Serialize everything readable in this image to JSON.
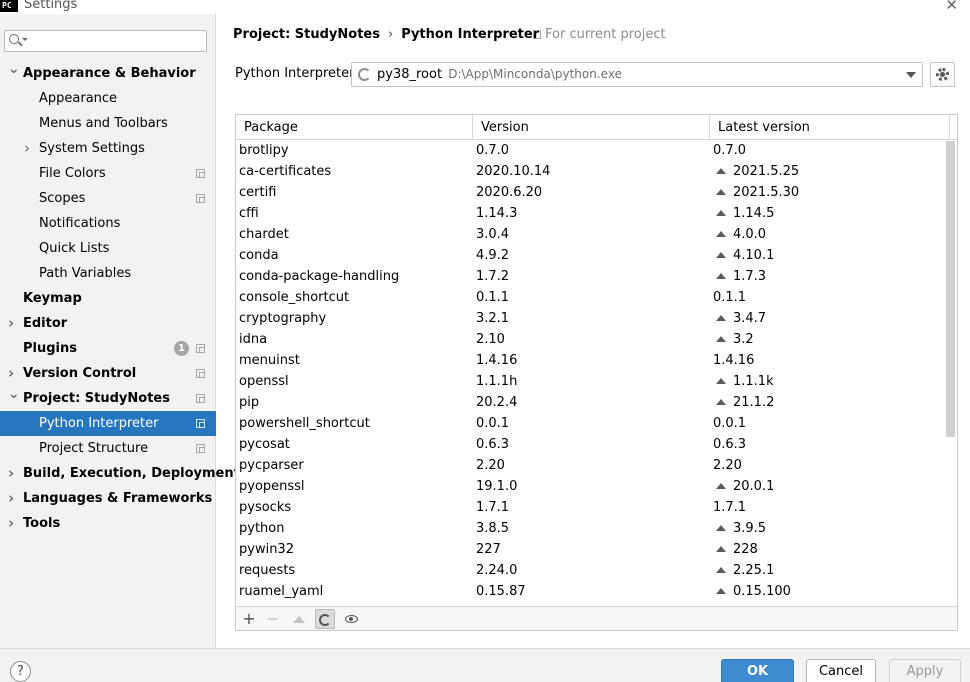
{
  "window": {
    "title": "Settings",
    "app_icon_text": "PC"
  },
  "search": {
    "placeholder": ""
  },
  "sidebar": {
    "items": [
      {
        "label": "Appearance & Behavior",
        "bold": true,
        "arrow": "down"
      },
      {
        "label": "Appearance",
        "child": true
      },
      {
        "label": "Menus and Toolbars",
        "child": true
      },
      {
        "label": "System Settings",
        "child": true,
        "arrow": "right"
      },
      {
        "label": "File Colors",
        "child": true,
        "copy": true
      },
      {
        "label": "Scopes",
        "child": true,
        "copy": true
      },
      {
        "label": "Notifications",
        "child": true
      },
      {
        "label": "Quick Lists",
        "child": true
      },
      {
        "label": "Path Variables",
        "child": true
      },
      {
        "label": "Keymap",
        "bold": true
      },
      {
        "label": "Editor",
        "bold": true,
        "arrow": "right"
      },
      {
        "label": "Plugins",
        "bold": true,
        "badge": "1",
        "copy": true
      },
      {
        "label": "Version Control",
        "bold": true,
        "arrow": "right",
        "copy": true
      },
      {
        "label": "Project: StudyNotes",
        "bold": true,
        "arrow": "down",
        "copy": true
      },
      {
        "label": "Python Interpreter",
        "child": true,
        "copy": true,
        "selected": true
      },
      {
        "label": "Project Structure",
        "child": true,
        "copy": true
      },
      {
        "label": "Build, Execution, Deployment",
        "bold": true,
        "arrow": "right"
      },
      {
        "label": "Languages & Frameworks",
        "bold": true,
        "arrow": "right"
      },
      {
        "label": "Tools",
        "bold": true,
        "arrow": "right"
      }
    ]
  },
  "breadcrumb": {
    "project": "Project: StudyNotes",
    "separator": "›",
    "page": "Python Interpreter"
  },
  "scope_note": "For current project",
  "interpreter": {
    "label": "Python Interpreter:",
    "name": "py38_root",
    "path": "D:\\App\\Minconda\\python.exe"
  },
  "table": {
    "columns": [
      "Package",
      "Version",
      "Latest version"
    ],
    "rows": [
      {
        "package": "brotlipy",
        "version": "0.7.0",
        "latest": "0.7.0",
        "upgrade": false
      },
      {
        "package": "ca-certificates",
        "version": "2020.10.14",
        "latest": "2021.5.25",
        "upgrade": true
      },
      {
        "package": "certifi",
        "version": "2020.6.20",
        "latest": "2021.5.30",
        "upgrade": true
      },
      {
        "package": "cffi",
        "version": "1.14.3",
        "latest": "1.14.5",
        "upgrade": true
      },
      {
        "package": "chardet",
        "version": "3.0.4",
        "latest": "4.0.0",
        "upgrade": true
      },
      {
        "package": "conda",
        "version": "4.9.2",
        "latest": "4.10.1",
        "upgrade": true
      },
      {
        "package": "conda-package-handling",
        "version": "1.7.2",
        "latest": "1.7.3",
        "upgrade": true
      },
      {
        "package": "console_shortcut",
        "version": "0.1.1",
        "latest": "0.1.1",
        "upgrade": false
      },
      {
        "package": "cryptography",
        "version": "3.2.1",
        "latest": "3.4.7",
        "upgrade": true
      },
      {
        "package": "idna",
        "version": "2.10",
        "latest": "3.2",
        "upgrade": true
      },
      {
        "package": "menuinst",
        "version": "1.4.16",
        "latest": "1.4.16",
        "upgrade": false
      },
      {
        "package": "openssl",
        "version": "1.1.1h",
        "latest": "1.1.1k",
        "upgrade": true
      },
      {
        "package": "pip",
        "version": "20.2.4",
        "latest": "21.1.2",
        "upgrade": true
      },
      {
        "package": "powershell_shortcut",
        "version": "0.0.1",
        "latest": "0.0.1",
        "upgrade": false
      },
      {
        "package": "pycosat",
        "version": "0.6.3",
        "latest": "0.6.3",
        "upgrade": false
      },
      {
        "package": "pycparser",
        "version": "2.20",
        "latest": "2.20",
        "upgrade": false
      },
      {
        "package": "pyopenssl",
        "version": "19.1.0",
        "latest": "20.0.1",
        "upgrade": true
      },
      {
        "package": "pysocks",
        "version": "1.7.1",
        "latest": "1.7.1",
        "upgrade": false
      },
      {
        "package": "python",
        "version": "3.8.5",
        "latest": "3.9.5",
        "upgrade": true
      },
      {
        "package": "pywin32",
        "version": "227",
        "latest": "228",
        "upgrade": true
      },
      {
        "package": "requests",
        "version": "2.24.0",
        "latest": "2.25.1",
        "upgrade": true
      },
      {
        "package": "ruamel_yaml",
        "version": "0.15.87",
        "latest": "0.15.100",
        "upgrade": true
      }
    ]
  },
  "toolbar": {
    "add": "+",
    "remove": "−",
    "upgrade_icon": "triangle-up-icon",
    "refresh_icon": "spinner-icon",
    "show_early_icon": "eye-icon"
  },
  "footer": {
    "help": "?",
    "ok": "OK",
    "cancel": "Cancel",
    "apply": "Apply"
  },
  "colors": {
    "selection": "#2675bf",
    "ok_button": "#3f8bd2",
    "sidebar_bg": "#f2f2f2"
  }
}
